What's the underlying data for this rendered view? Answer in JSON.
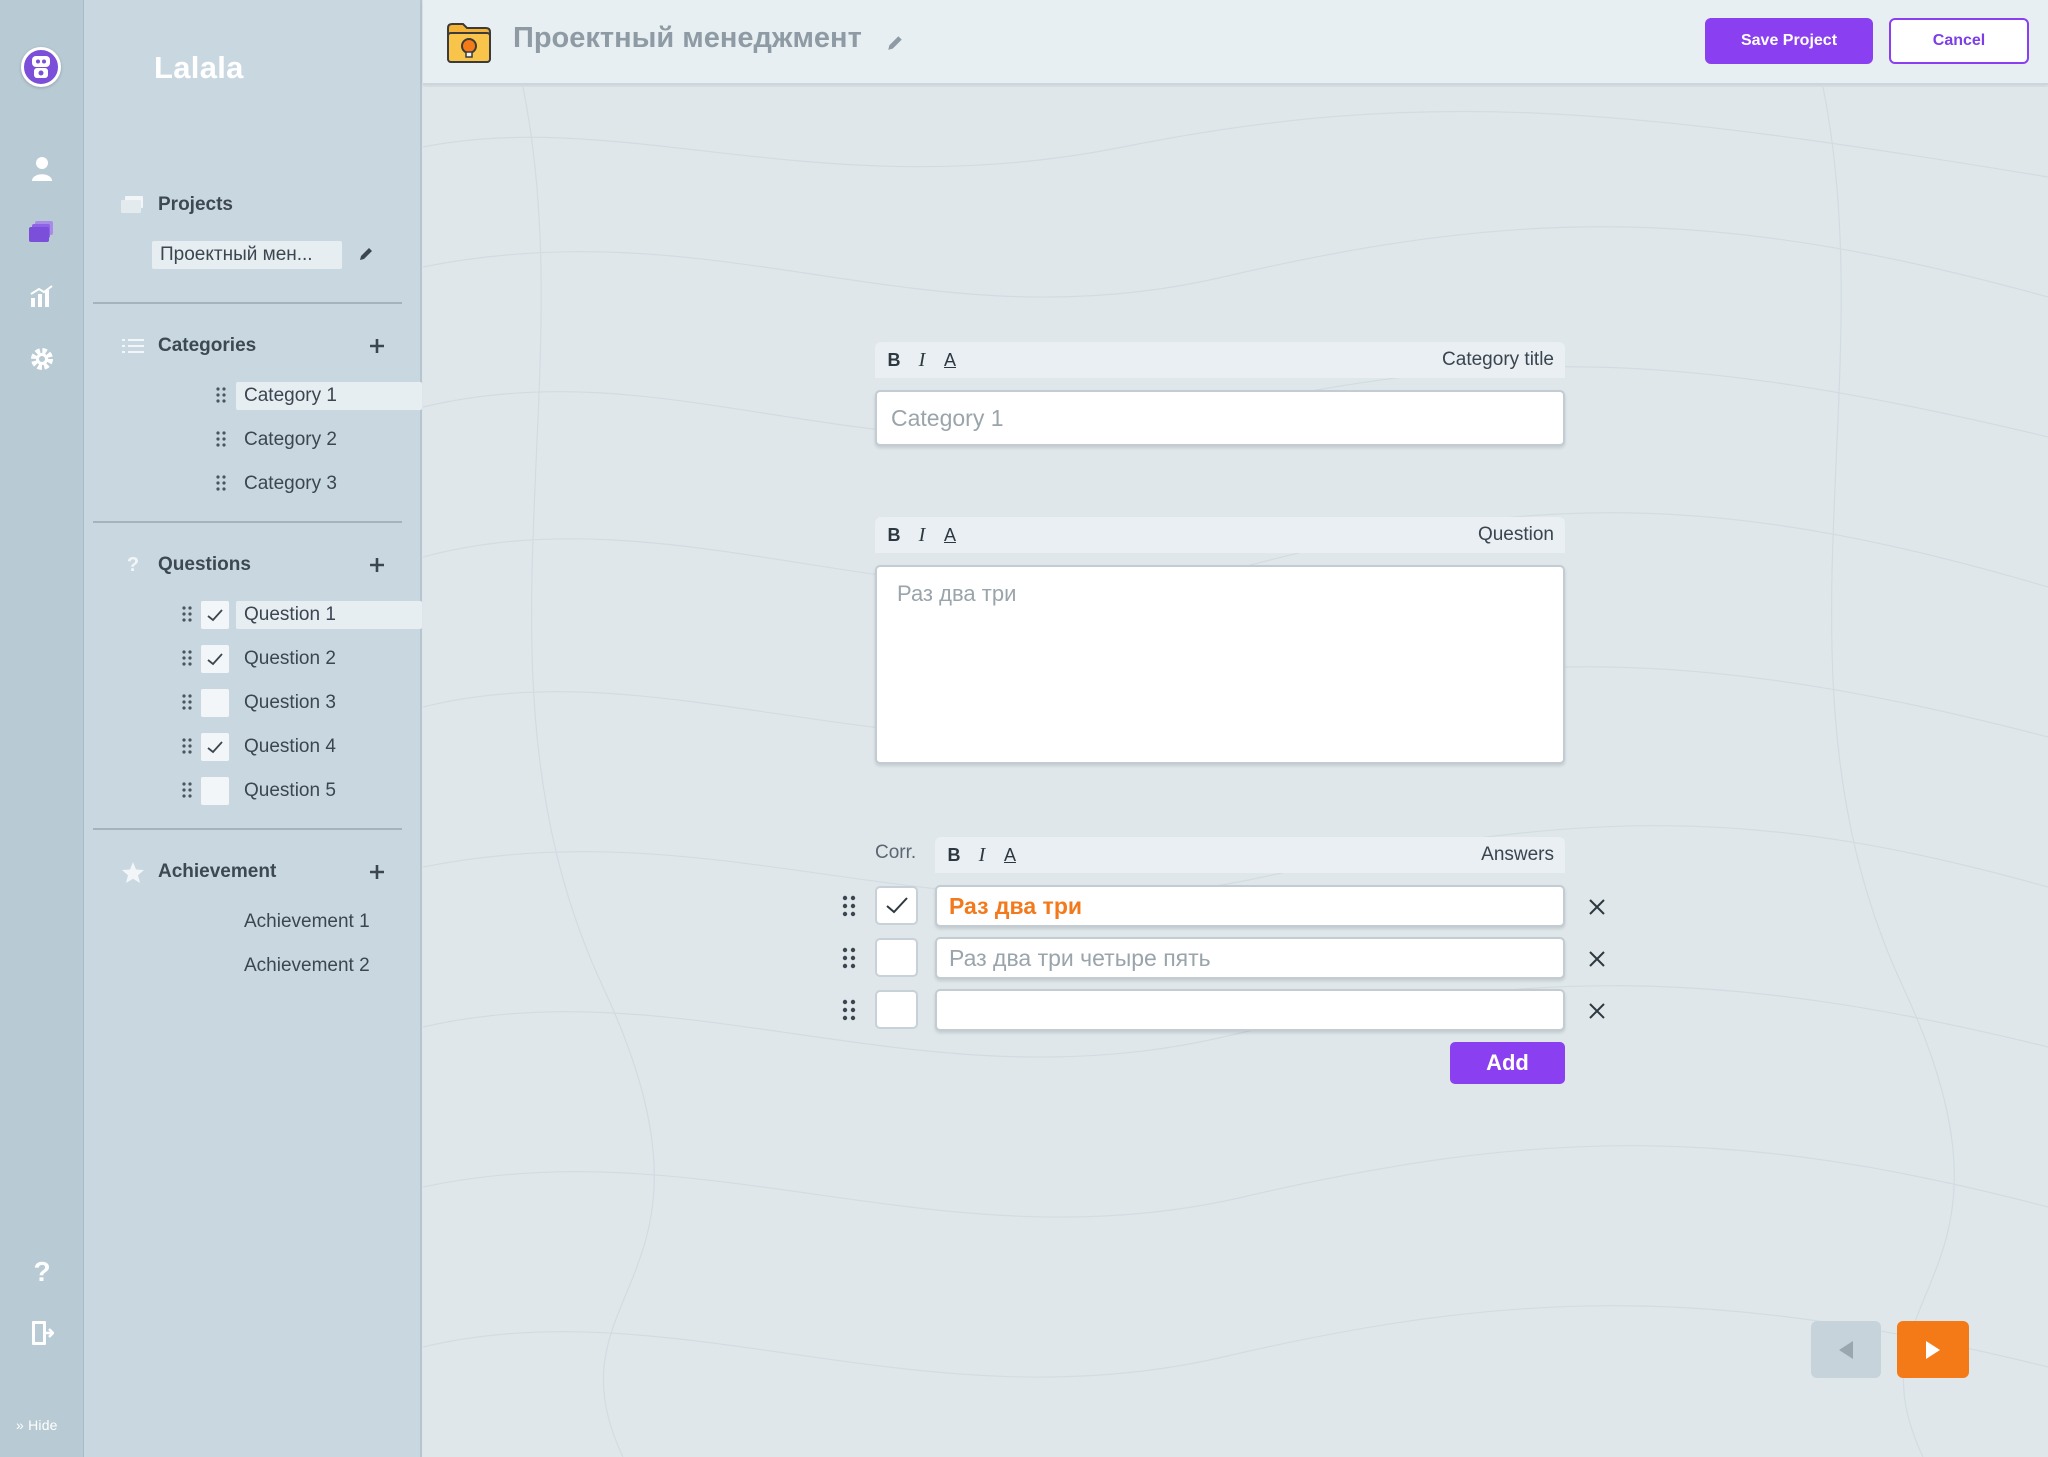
{
  "app": {
    "brand": "Lalala",
    "hide_label": "» Hide"
  },
  "rail": {
    "icons": [
      "avatar-icon",
      "user-icon",
      "projects-icon",
      "stats-icon",
      "gear-icon",
      "help-icon",
      "logout-icon"
    ]
  },
  "sidebar": {
    "projects": {
      "title": "Projects",
      "items": [
        {
          "label": "Проектный мен..."
        }
      ]
    },
    "categories": {
      "title": "Categories",
      "items": [
        {
          "label": "Category 1",
          "active": true
        },
        {
          "label": "Category 2"
        },
        {
          "label": "Category 3"
        }
      ]
    },
    "questions": {
      "title": "Questions",
      "items": [
        {
          "label": "Question 1",
          "checked": true,
          "active": true
        },
        {
          "label": "Question 2",
          "checked": true
        },
        {
          "label": "Question 3",
          "checked": false
        },
        {
          "label": "Question 4",
          "checked": true
        },
        {
          "label": "Question 5",
          "checked": false
        }
      ]
    },
    "achievement": {
      "title": "Achievement",
      "items": [
        {
          "label": "Achievement 1"
        },
        {
          "label": "Achievement 2"
        }
      ]
    }
  },
  "header": {
    "project_title": "Проектный менеджмент",
    "save_label": "Save Project",
    "cancel_label": "Cancel"
  },
  "editor": {
    "format_buttons": {
      "bold": "B",
      "italic": "I",
      "color": "A"
    },
    "category": {
      "toolbar_label": "Category title",
      "placeholder": "Category 1",
      "value": "Category 1"
    },
    "question": {
      "toolbar_label": "Question",
      "value": "Раз два три"
    },
    "answers": {
      "corr_label": "Corr.",
      "toolbar_label": "Answers",
      "items": [
        {
          "value": "Раз два три",
          "correct": true
        },
        {
          "value": "Раз два три четыре пять",
          "correct": false
        },
        {
          "value": "",
          "correct": false
        }
      ],
      "add_label": "Add"
    }
  },
  "colors": {
    "accent": "#8a3ff0",
    "correct_answer": "#f27a1c",
    "next_button": "#f47a17"
  }
}
